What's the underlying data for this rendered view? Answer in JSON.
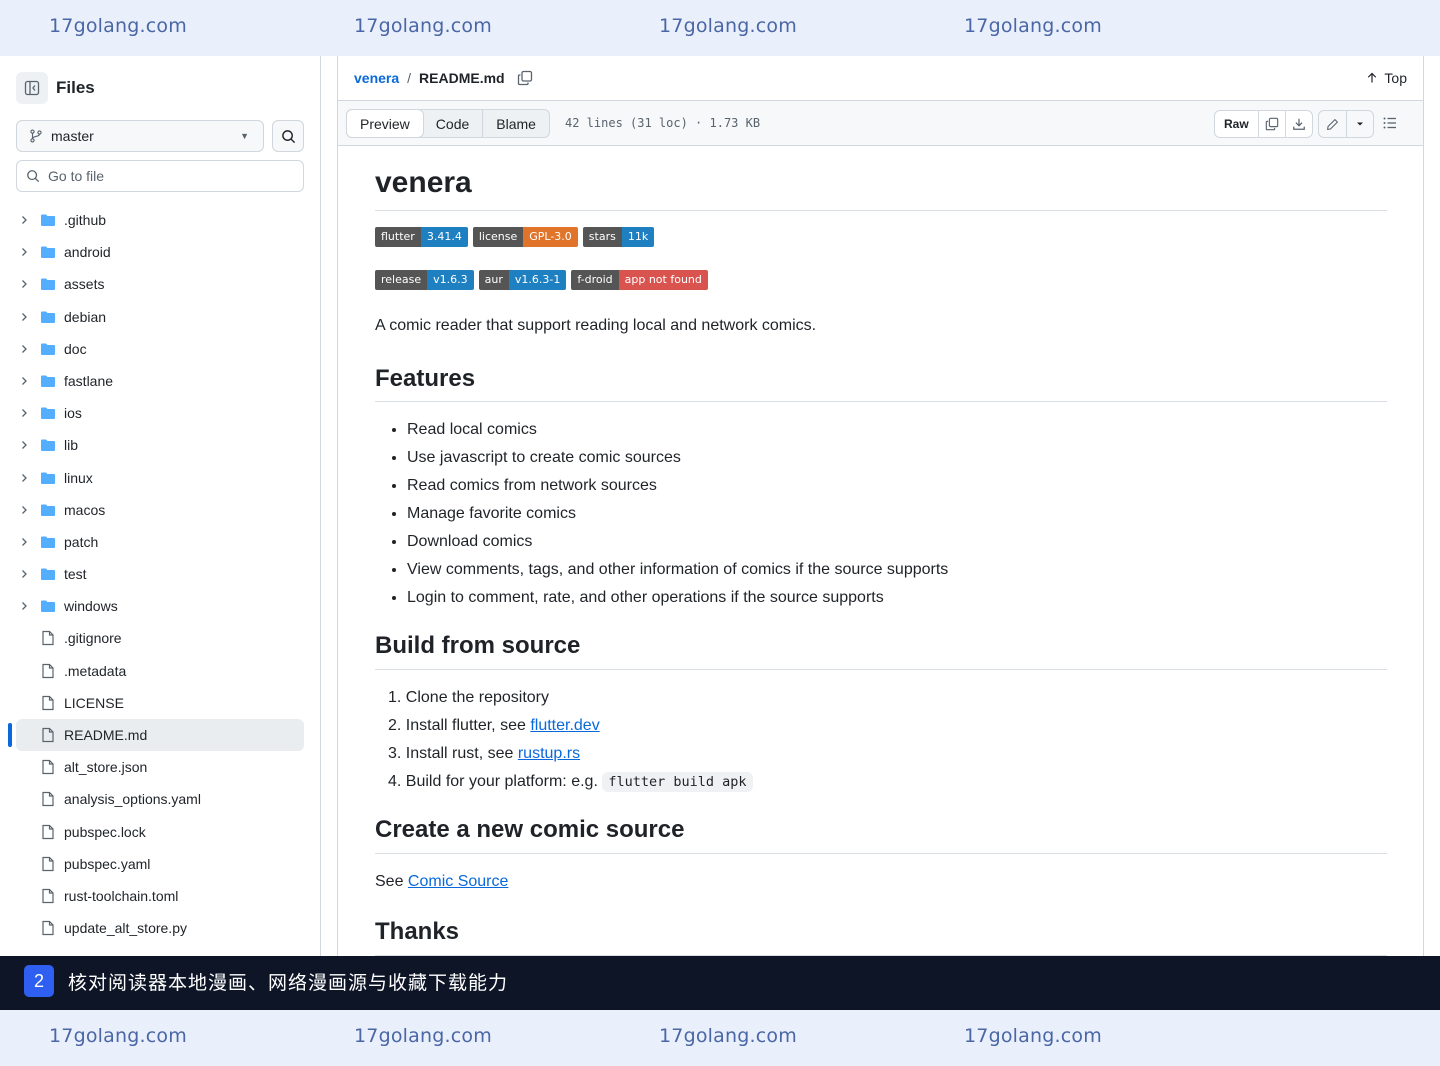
{
  "watermark": {
    "text": "17golang.com"
  },
  "sidebar": {
    "title": "Files",
    "branch": "master",
    "goto_placeholder": "Go to file",
    "items": [
      {
        "name": ".github",
        "type": "dir"
      },
      {
        "name": "android",
        "type": "dir"
      },
      {
        "name": "assets",
        "type": "dir"
      },
      {
        "name": "debian",
        "type": "dir"
      },
      {
        "name": "doc",
        "type": "dir"
      },
      {
        "name": "fastlane",
        "type": "dir"
      },
      {
        "name": "ios",
        "type": "dir"
      },
      {
        "name": "lib",
        "type": "dir"
      },
      {
        "name": "linux",
        "type": "dir"
      },
      {
        "name": "macos",
        "type": "dir"
      },
      {
        "name": "patch",
        "type": "dir"
      },
      {
        "name": "test",
        "type": "dir"
      },
      {
        "name": "windows",
        "type": "dir"
      },
      {
        "name": ".gitignore",
        "type": "file"
      },
      {
        "name": ".metadata",
        "type": "file"
      },
      {
        "name": "LICENSE",
        "type": "file"
      },
      {
        "name": "README.md",
        "type": "file",
        "active": true
      },
      {
        "name": "alt_store.json",
        "type": "file"
      },
      {
        "name": "analysis_options.yaml",
        "type": "file"
      },
      {
        "name": "pubspec.lock",
        "type": "file"
      },
      {
        "name": "pubspec.yaml",
        "type": "file"
      },
      {
        "name": "rust-toolchain.toml",
        "type": "file"
      },
      {
        "name": "update_alt_store.py",
        "type": "file"
      }
    ]
  },
  "header": {
    "repo": "venera",
    "sep": "/",
    "file": "README.md",
    "top_label": "Top"
  },
  "filebar": {
    "tabs": [
      "Preview",
      "Code",
      "Blame"
    ],
    "info": "42 lines (31 loc) · 1.73 KB",
    "raw_label": "Raw"
  },
  "readme": {
    "title": "venera",
    "badges_row1": [
      {
        "k": "flutter",
        "v": "3.41.4",
        "color": "#1e7fc1"
      },
      {
        "k": "license",
        "v": "GPL-3.0",
        "color": "#e0742a"
      },
      {
        "k": "stars",
        "v": "11k",
        "color": "#1e7fc1"
      }
    ],
    "badges_row2": [
      {
        "k": "release",
        "v": "v1.6.3",
        "color": "#1e7fc1"
      },
      {
        "k": "aur",
        "v": "v1.6.3-1",
        "color": "#1e7fc1"
      },
      {
        "k": "f-droid",
        "v": "app not found",
        "color": "#d9534f"
      }
    ],
    "intro": "A comic reader that support reading local and network comics.",
    "features_heading": "Features",
    "features": [
      "Read local comics",
      "Use javascript to create comic sources",
      "Read comics from network sources",
      "Manage favorite comics",
      "Download comics",
      "View comments, tags, and other information of comics if the source supports",
      "Login to comment, rate, and other operations if the source supports"
    ],
    "build_heading": "Build from source",
    "build_steps": {
      "s1": "Clone the repository",
      "s2_prefix": "Install flutter, see ",
      "s2_link": "flutter.dev",
      "s3_prefix": "Install rust, see ",
      "s3_link": "rustup.rs",
      "s4_prefix": "Build for your platform: e.g. ",
      "s4_code": "flutter build apk"
    },
    "create_heading": "Create a new comic source",
    "create_prefix": "See ",
    "create_link": "Comic Source",
    "thanks_heading": "Thanks"
  },
  "caption": {
    "number": "2",
    "text": "核对阅读器本地漫画、网络漫画源与收藏下载能力"
  }
}
